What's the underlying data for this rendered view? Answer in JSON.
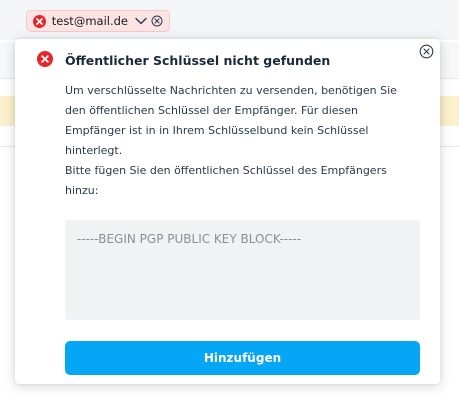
{
  "recipient_chip": {
    "email": "test@mail.de",
    "status": "error",
    "icons": [
      "error-icon",
      "chevron-down-icon",
      "remove-circle-icon"
    ]
  },
  "popover": {
    "title": "Öffentlicher Schlüssel nicht gefunden",
    "paragraph1": "Um verschlüsselte Nachrichten zu versenden, benötigen Sie den öffentlichen Schlüssel der Empfänger. Für diesen Empfänger ist in in Ihrem Schlüsselbund kein Schlüssel hinterlegt.",
    "paragraph2": "Bitte fügen Sie den öffentlichen Schlüssel des Empfängers hinzu:",
    "key_placeholder": "-----BEGIN PGP PUBLIC KEY BLOCK-----",
    "key_value": "",
    "submit_label": "Hinzufügen",
    "icons": [
      "error-icon",
      "close-icon"
    ]
  },
  "colors": {
    "error": "#e5262d",
    "accent": "#06a6f7",
    "warning_bg": "#fbf1cc",
    "chip_bg": "#fde4e4"
  }
}
